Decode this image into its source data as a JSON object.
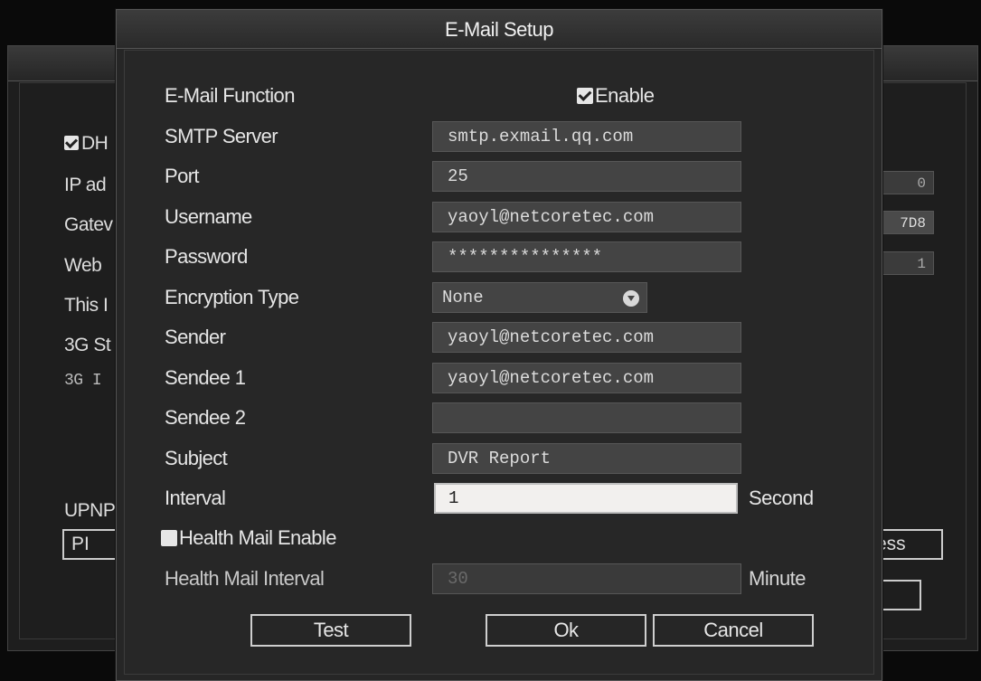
{
  "background_window": {
    "dhcp_label": "DH",
    "labels": [
      "IP ad",
      "Gatev",
      "Web",
      "This I",
      "3G St"
    ],
    "mono_label": "3G I",
    "upnp_label": "UPNP",
    "fields": [
      "0",
      "7D8",
      "1"
    ],
    "button_left": "PI",
    "button_right": "ess"
  },
  "dialog": {
    "title": "E-Mail Setup",
    "email_function": {
      "label": "E-Mail Function",
      "enable_label": "Enable",
      "checked": true
    },
    "smtp_server": {
      "label": "SMTP Server",
      "value": "smtp.exmail.qq.com"
    },
    "port": {
      "label": "Port",
      "value": "25"
    },
    "username": {
      "label": "Username",
      "value": "yaoyl@netcoretec.com"
    },
    "password": {
      "label": "Password",
      "value": "***************"
    },
    "encryption": {
      "label": "Encryption Type",
      "value": "None"
    },
    "sender": {
      "label": "Sender",
      "value": "yaoyl@netcoretec.com"
    },
    "sendee1": {
      "label": "Sendee 1",
      "value": "yaoyl@netcoretec.com"
    },
    "sendee2": {
      "label": "Sendee 2",
      "value": ""
    },
    "subject": {
      "label": "Subject",
      "value": "DVR Report"
    },
    "interval": {
      "label": "Interval",
      "value": "1",
      "unit": "Second"
    },
    "health_mail": {
      "label": "Health Mail Enable",
      "checked": false
    },
    "health_interval": {
      "label": "Health Mail Interval",
      "value": "30",
      "unit": "Minute"
    },
    "buttons": {
      "test": "Test",
      "ok": "Ok",
      "cancel": "Cancel"
    }
  }
}
